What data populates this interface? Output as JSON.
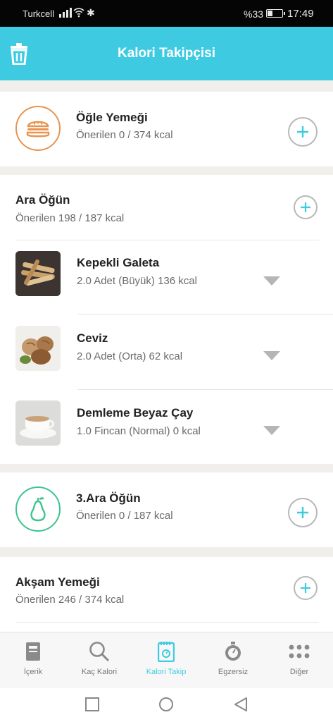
{
  "status_bar": {
    "carrier": "Turkcell",
    "battery": "%33",
    "time": "17:49"
  },
  "header": {
    "title": "Kalori Takipçisi"
  },
  "meals": [
    {
      "title": "Öğle Yemeği",
      "subtitle": "Önerilen 0 / 374 kcal",
      "icon": "burger-icon",
      "color": "#e8944e"
    },
    {
      "title": "Ara Öğün",
      "subtitle": "Önerilen 198 / 187 kcal"
    },
    {
      "title": "3.Ara Öğün",
      "subtitle": "Önerilen 0 / 187 kcal",
      "icon": "pear-icon",
      "color": "#3cc48f"
    },
    {
      "title": "Akşam Yemeği",
      "subtitle": "Önerilen 246 / 374 kcal"
    }
  ],
  "foods": [
    {
      "name": "Kepekli Galeta",
      "detail": "2.0 Adet (Büyük) 136 kcal",
      "icon": "breadsticks-image"
    },
    {
      "name": "Ceviz",
      "detail": "2.0 Adet (Orta) 62 kcal",
      "icon": "walnut-image"
    },
    {
      "name": "Demleme Beyaz Çay",
      "detail": "1.0 Fincan (Normal) 0 kcal",
      "icon": "tea-cup-image"
    }
  ],
  "tabs": [
    {
      "label": "İçerik",
      "icon": "book-icon"
    },
    {
      "label": "Kaç Kalori",
      "icon": "search-icon"
    },
    {
      "label": "Kalori Takip",
      "icon": "tracker-icon",
      "active": true
    },
    {
      "label": "Egzersiz",
      "icon": "stopwatch-icon"
    },
    {
      "label": "Diğer",
      "icon": "more-dots-icon"
    }
  ],
  "colors": {
    "accent": "#3ecbe2",
    "plus": "#3ecbe2"
  }
}
